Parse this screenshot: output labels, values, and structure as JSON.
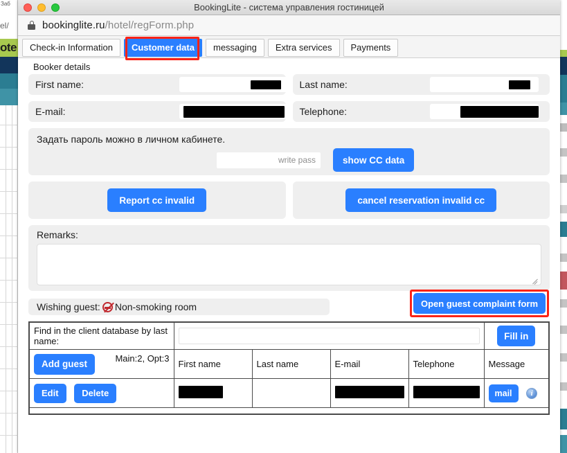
{
  "window": {
    "title": "BookingLite - система управления гостиницей",
    "traffic_lights": [
      "close",
      "minimize",
      "maximize"
    ]
  },
  "url_bar": {
    "lock_icon": "lock-icon",
    "host": "bookinglite.ru",
    "path": "/hotel/regForm.php"
  },
  "tabs": [
    {
      "label": "Check-in Information",
      "active": false
    },
    {
      "label": "Customer data",
      "active": true
    },
    {
      "label": "messaging",
      "active": false
    },
    {
      "label": "Extra services",
      "active": false
    },
    {
      "label": "Payments",
      "active": false
    }
  ],
  "section": {
    "booker_details": "Booker details"
  },
  "fields": {
    "first_name": {
      "label": "First name:",
      "value": ""
    },
    "last_name": {
      "label": "Last name:",
      "value": ""
    },
    "email": {
      "label": "E-mail:",
      "value": ""
    },
    "telephone": {
      "label": "Telephone:",
      "value": ""
    }
  },
  "password_block": {
    "hint": "Задать пароль можно в личном кабинете.",
    "write_pass_placeholder": "write pass",
    "write_pass_value": "",
    "show_cc_label": "show CC data"
  },
  "cc_actions": {
    "report_invalid": "Report cc invalid",
    "cancel_reservation": "cancel reservation invalid cc"
  },
  "remarks": {
    "label": "Remarks:",
    "value": ""
  },
  "wishing": {
    "label": "Wishing guest:",
    "icon": "no-smoking-icon",
    "value": "Non-smoking room"
  },
  "complaint": {
    "label": "Open guest complaint form"
  },
  "search": {
    "label": "Find in the client database by last name:",
    "value": "",
    "fill_in_label": "Fill in"
  },
  "guest_table": {
    "add_guest_label": "Add guest",
    "counts": "Main:2, Opt:3",
    "headers": [
      "First name",
      "Last name",
      "E-mail",
      "Telephone",
      "Message"
    ],
    "rows": [
      {
        "edit_label": "Edit",
        "delete_label": "Delete",
        "first_name": "",
        "last_name": "",
        "email": "",
        "telephone": "",
        "mail_label": "mail",
        "info_glyph": "i"
      }
    ]
  },
  "colors": {
    "accent_blue": "#2a7fff",
    "highlight_red": "#fb2316",
    "panel_gray": "#efefef",
    "no_smoking_red": "#c0272d"
  },
  "background_window": {
    "tab_hint": "Заб",
    "url_hint": "el/",
    "badge_hint": "ote"
  }
}
